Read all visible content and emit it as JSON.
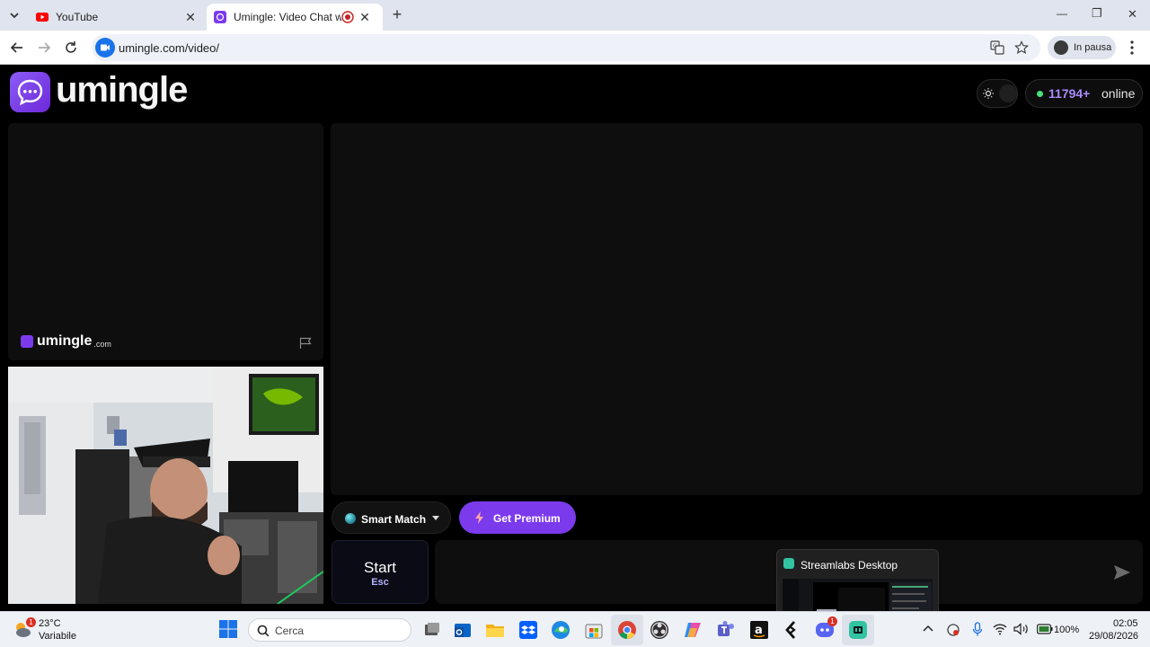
{
  "browser": {
    "tabs": [
      {
        "title": "YouTube"
      },
      {
        "title": "Umingle: Video Chat with S"
      }
    ],
    "new_tab": "+",
    "url": "umingle.com/video/",
    "profile_label": "In pausa",
    "window_controls": {
      "minimize": "—",
      "restore": "❐",
      "close": "✕"
    }
  },
  "site": {
    "logo": "umingle",
    "online_count": "11794+",
    "online_label": "online",
    "watermark": {
      "name": "umingle",
      "suffix": ".com"
    },
    "smart_match_label": "Smart Match",
    "premium_label": "Get Premium",
    "start_label": "Start",
    "start_shortcut": "Esc"
  },
  "tooltip": {
    "app_name": "Streamlabs Desktop"
  },
  "taskbar": {
    "weather_temp": "23°C",
    "weather_desc": "Variabile",
    "weather_badge": "1",
    "search_placeholder": "Cerca",
    "discord_badge": "1",
    "battery": "100%",
    "time": "02:05",
    "date": "29/08/2026"
  },
  "colors": {
    "accent": "#7c3aed",
    "online_dot": "#4ade80",
    "online_count": "#a78bfa"
  }
}
